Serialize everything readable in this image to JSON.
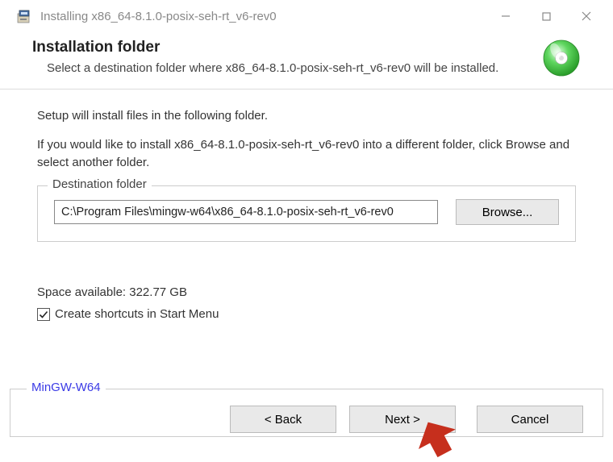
{
  "titlebar": {
    "text": "Installing x86_64-8.1.0-posix-seh-rt_v6-rev0"
  },
  "header": {
    "title": "Installation folder",
    "subtitle": "Select a destination folder where x86_64-8.1.0-posix-seh-rt_v6-rev0 will be installed."
  },
  "body": {
    "line1": "Setup will install files in the following folder.",
    "line2": "If you would like to install x86_64-8.1.0-posix-seh-rt_v6-rev0 into a different folder, click Browse and select another folder.",
    "fieldset_label": "Destination folder",
    "path": "C:\\Program Files\\mingw-w64\\x86_64-8.1.0-posix-seh-rt_v6-rev0",
    "browse_label": "Browse...",
    "space_available": "Space available: 322.77 GB",
    "checkbox_label": "Create shortcuts in Start Menu",
    "checkbox_checked": true
  },
  "footer": {
    "brand": "MinGW-W64",
    "back_label": "< Back",
    "next_label": "Next >",
    "cancel_label": "Cancel"
  }
}
